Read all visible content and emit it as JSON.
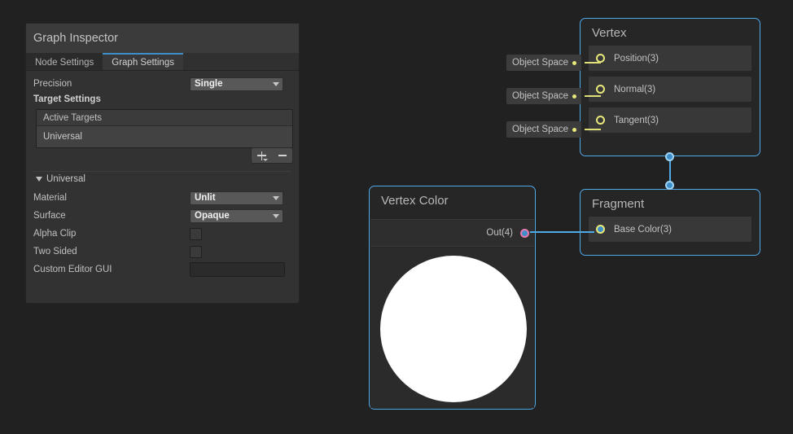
{
  "inspector": {
    "title": "Graph Inspector",
    "tabs": [
      {
        "label": "Node Settings",
        "active": false
      },
      {
        "label": "Graph Settings",
        "active": true
      }
    ],
    "precision": {
      "label": "Precision",
      "value": "Single"
    },
    "target_settings_title": "Target Settings",
    "active_targets": {
      "header": "Active Targets",
      "items": [
        "Universal"
      ],
      "add_button": "+",
      "remove_button": "−"
    },
    "universal_section": {
      "title": "Universal",
      "material": {
        "label": "Material",
        "value": "Unlit"
      },
      "surface": {
        "label": "Surface",
        "value": "Opaque"
      },
      "alpha_clip": {
        "label": "Alpha Clip",
        "checked": false
      },
      "two_sided": {
        "label": "Two Sided",
        "checked": false
      },
      "custom_editor_gui": {
        "label": "Custom Editor GUI",
        "value": ""
      }
    }
  },
  "graph": {
    "vertex_node": {
      "title": "Vertex",
      "blocks": [
        {
          "label": "Position(3)",
          "space": "Object Space"
        },
        {
          "label": "Normal(3)",
          "space": "Object Space"
        },
        {
          "label": "Tangent(3)",
          "space": "Object Space"
        }
      ]
    },
    "fragment_node": {
      "title": "Fragment",
      "blocks": [
        {
          "label": "Base Color(3)"
        }
      ]
    },
    "vertex_color_node": {
      "title": "Vertex Color",
      "output_port": "Out(4)"
    }
  },
  "colors": {
    "canvas": "#212121",
    "selection_blue": "#4fa8e8",
    "port_vector3": "#e8e87a",
    "port_vector4": "#e87ab0",
    "accent_tab": "#3d8ec9"
  }
}
